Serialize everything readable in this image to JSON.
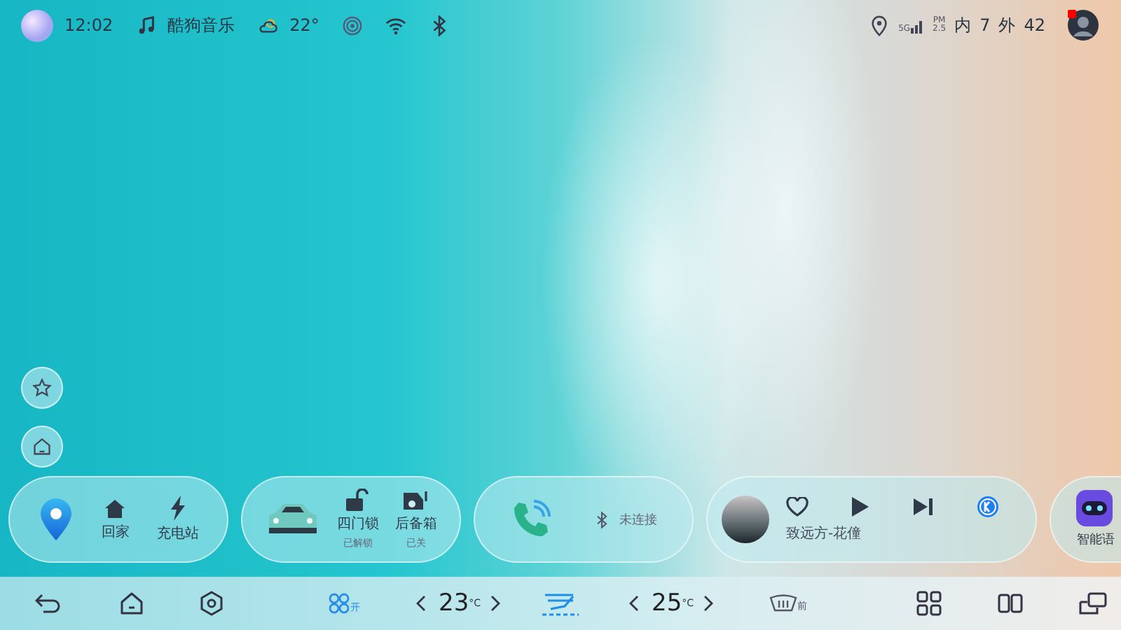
{
  "status_bar": {
    "time": "12:02",
    "music_app": "酷狗音乐",
    "weather_temp": "22°",
    "network": "5G",
    "pm_label": "PM",
    "pm_value": "2.5",
    "inside_label": "内",
    "inside_value": "7",
    "outside_label": "外",
    "outside_value": "42",
    "notification": true
  },
  "cards": [
    {
      "kind": "nav",
      "items": [
        {
          "label": "回家"
        },
        {
          "label": "充电站"
        }
      ]
    },
    {
      "kind": "car",
      "items": [
        {
          "label": "四门锁",
          "status": "已解锁"
        },
        {
          "label": "后备箱",
          "status": "已关"
        }
      ]
    },
    {
      "kind": "phone",
      "bluetooth_status": "未连接"
    },
    {
      "kind": "music",
      "song": "致远方-花僮",
      "liked": false,
      "playing": false
    },
    {
      "kind": "voice",
      "label": "智能语"
    }
  ],
  "climate": {
    "fan_label": "开",
    "fan_on": true,
    "driver_temp": "23",
    "driver_unit": "°C",
    "seat_heat_on": true,
    "passenger_temp": "25",
    "passenger_unit": "°C",
    "defrost_label": "前",
    "defrost_on": false
  }
}
